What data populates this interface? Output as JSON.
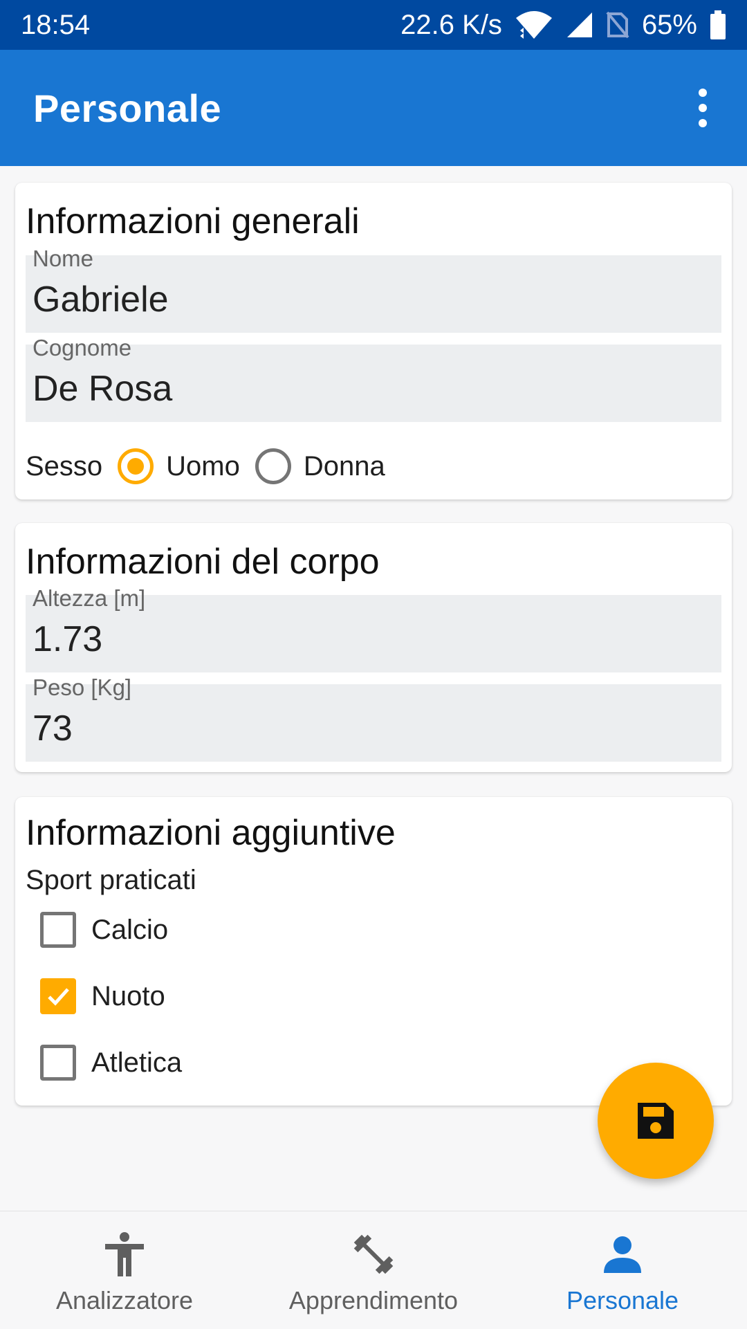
{
  "status_bar": {
    "time": "18:54",
    "network_speed": "22.6 K/s",
    "battery": "65%"
  },
  "app_bar": {
    "title": "Personale"
  },
  "general": {
    "title": "Informazioni generali",
    "name_label": "Nome",
    "name_value": "Gabriele",
    "surname_label": "Cognome",
    "surname_value": "De Rosa",
    "sex_label": "Sesso",
    "sex_options": [
      {
        "label": "Uomo",
        "checked": true
      },
      {
        "label": "Donna",
        "checked": false
      }
    ]
  },
  "body": {
    "title": "Informazioni del corpo",
    "height_label": "Altezza [m]",
    "height_value": "1.73",
    "weight_label": "Peso [Kg]",
    "weight_value": "73"
  },
  "additional": {
    "title": "Informazioni aggiuntive",
    "sports_label": "Sport praticati",
    "sports": [
      {
        "label": "Calcio",
        "checked": false
      },
      {
        "label": "Nuoto",
        "checked": true
      },
      {
        "label": "Atletica",
        "checked": false
      }
    ]
  },
  "fab": {
    "icon": "save-icon",
    "color": "#ffab00"
  },
  "bottom_nav": {
    "items": [
      {
        "label": "Analizzatore",
        "icon": "person-standing-icon",
        "active": false
      },
      {
        "label": "Apprendimento",
        "icon": "dumbbell-icon",
        "active": false
      },
      {
        "label": "Personale",
        "icon": "person-icon",
        "active": true
      }
    ]
  },
  "colors": {
    "status_bar": "#0049a0",
    "app_bar": "#1976d2",
    "accent": "#ffab00",
    "nav_active": "#1976d2"
  }
}
